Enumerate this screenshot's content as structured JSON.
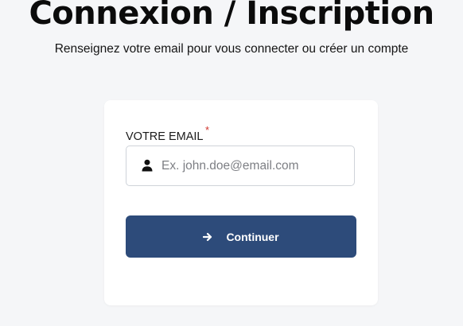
{
  "page": {
    "title": "Connexion / Inscription",
    "subtitle": "Renseignez votre email pour vous connecter ou créer un compte"
  },
  "form": {
    "email_label": "VOTRE EMAIL",
    "required_mark": "*",
    "email_placeholder": "Ex. john.doe@email.com",
    "email_value": "",
    "continue_label": "Continuer"
  },
  "icons": {
    "email_field": "user-icon",
    "continue_button": "arrow-right-icon"
  },
  "colors": {
    "background": "#f5f6f8",
    "card": "#ffffff",
    "primary_button": "#2d4b7a",
    "required": "#d0342c"
  }
}
